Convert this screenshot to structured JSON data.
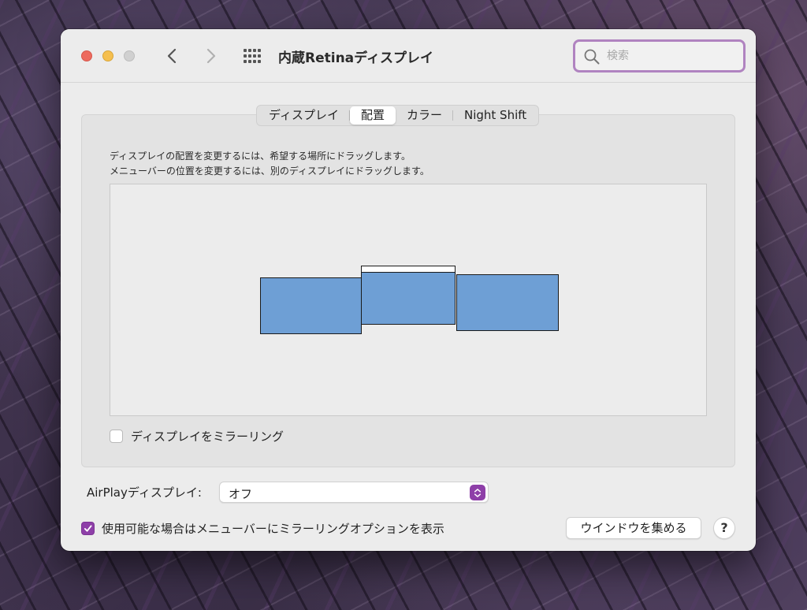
{
  "window": {
    "title": "内蔵Retinaディスプレイ"
  },
  "search": {
    "placeholder": "検索",
    "value": ""
  },
  "tabs": [
    {
      "label": "ディスプレイ",
      "active": false
    },
    {
      "label": "配置",
      "active": true
    },
    {
      "label": "カラー",
      "active": false
    },
    {
      "label": "Night Shift",
      "active": false
    }
  ],
  "arrangement": {
    "instruction_line1": "ディスプレイの配置を変更するには、希望する場所にドラッグします。",
    "instruction_line2": "メニューバーの位置を変更するには、別のディスプレイにドラッグします。",
    "display_color": "#6e9fd5",
    "display_count": 3,
    "menubar_on_display": 2
  },
  "mirroring": {
    "label": "ディスプレイをミラーリング",
    "checked": false
  },
  "airplay": {
    "label": "AirPlayディスプレイ:",
    "selected": "オフ"
  },
  "menu_option": {
    "label": "使用可能な場合はメニューバーにミラーリングオプションを表示",
    "checked": true
  },
  "buttons": {
    "gather_windows": "ウインドウを集める",
    "help": "?"
  },
  "colors": {
    "accent": "#8e3fa8",
    "search_focus": "#b083c0"
  }
}
